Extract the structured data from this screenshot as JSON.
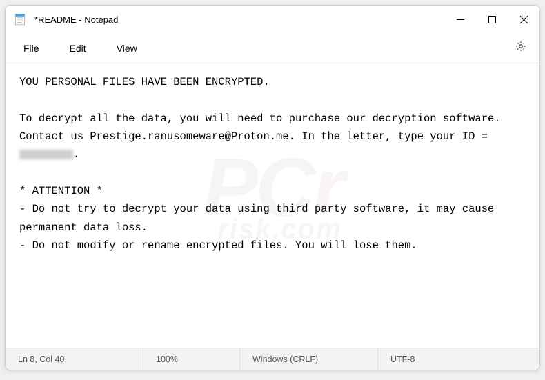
{
  "window": {
    "title": "*README - Notepad"
  },
  "menu": {
    "file": "File",
    "edit": "Edit",
    "view": "View"
  },
  "content": {
    "line1": "YOU PERSONAL FILES HAVE BEEN ENCRYPTED.",
    "line2": "",
    "line3": "To decrypt all the data, you will need to purchase our decryption software.",
    "line4a": "Contact us Prestige.ranusomeware@Proton.me. In the letter, type your ID = ",
    "line4b": ".",
    "line5": "",
    "line6": "* ATTENTION *",
    "line7": "- Do not try to decrypt your data using third party software, it may cause permanent data loss.",
    "line8": "- Do not modify or rename encrypted files. You will lose them."
  },
  "status": {
    "position": "Ln 8, Col 40",
    "zoom": "100%",
    "line_ending": "Windows (CRLF)",
    "encoding": "UTF-8"
  }
}
